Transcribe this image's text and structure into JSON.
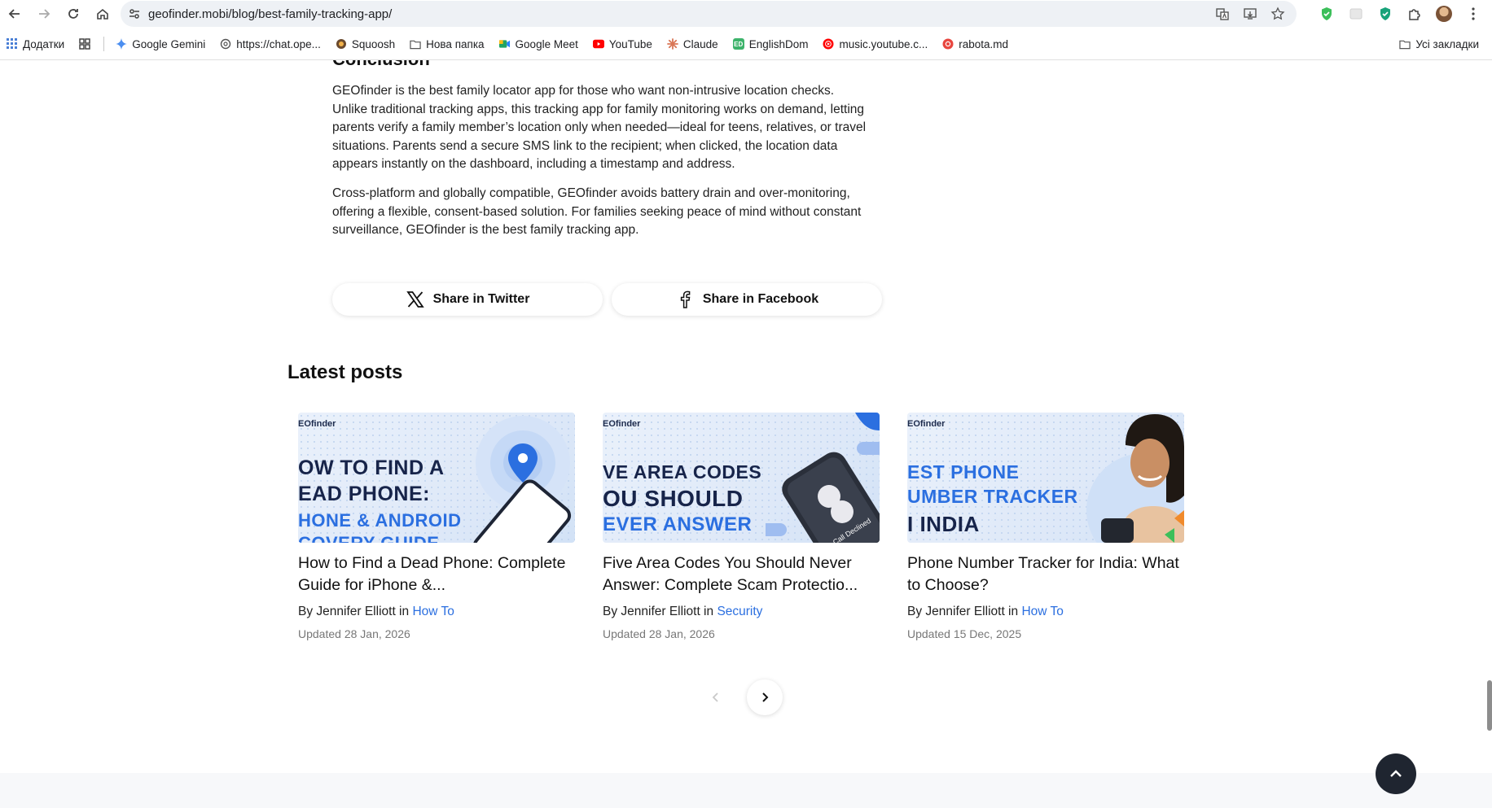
{
  "browser": {
    "url": "geofinder.mobi/blog/best-family-tracking-app/",
    "bookmarks": [
      {
        "label": "Додатки",
        "icon": "apps-grid-icon"
      },
      {
        "label": "Google Gemini",
        "icon": "gemini-icon"
      },
      {
        "label": "https://chat.ope...",
        "icon": "openai-icon"
      },
      {
        "label": "Squoosh",
        "icon": "squoosh-icon"
      },
      {
        "label": "Нова папка",
        "icon": "folder-icon"
      },
      {
        "label": "Google Meet",
        "icon": "meet-icon"
      },
      {
        "label": "YouTube",
        "icon": "youtube-icon"
      },
      {
        "label": "Claude",
        "icon": "claude-icon"
      },
      {
        "label": "EnglishDom",
        "icon": "englishdom-icon"
      },
      {
        "label": "music.youtube.c...",
        "icon": "youtube-music-icon"
      },
      {
        "label": "rabota.md",
        "icon": "rabota-icon"
      }
    ],
    "all_bookmarks": "Усі закладки"
  },
  "article": {
    "heading_cut": "Conclusion",
    "paragraphs": [
      "GEOfinder is the best family locator app for those who want non-intrusive location checks. Unlike traditional tracking apps, this tracking app for family monitoring works on demand, letting parents verify a family member’s location only when needed—ideal for teens, relatives, or travel situations. Parents send a secure SMS link to the recipient; when clicked, the location data appears instantly on the dashboard, including a timestamp and address.",
      "Cross-platform and globally compatible, GEOfinder avoids battery drain and over-monitoring, offering a flexible, consent-based solution. For families seeking peace of mind without constant surveillance, GEOfinder is the best family tracking app."
    ],
    "share_twitter": "Share in Twitter",
    "share_facebook": "Share in Facebook"
  },
  "latest": {
    "title": "Latest posts",
    "cards": [
      {
        "image_brand": "EOfinder",
        "image_lines": [
          "OW TO FIND A",
          "EAD PHONE:",
          "HONE & ANDROID",
          "COVERY GUIDE"
        ],
        "title": "How to Find a Dead Phone: Complete Guide for iPhone &...",
        "by": "By Jennifer Elliott in",
        "category": "How To",
        "date": "Updated 28 Jan, 2026"
      },
      {
        "image_brand": "EOfinder",
        "image_lines": [
          "VE AREA CODES",
          "OU SHOULD",
          "EVER ANSWER"
        ],
        "image_phone_text": "Call Declined",
        "title": "Five Area Codes You Should Never Answer: Complete Scam Protectio...",
        "by": "By Jennifer Elliott in",
        "category": "Security",
        "date": "Updated 28 Jan, 2026"
      },
      {
        "image_brand": "EOfinder",
        "image_lines": [
          "EST PHONE",
          "UMBER TRACKER",
          "I INDIA"
        ],
        "title": "Phone Number Tracker for India: What to Choose?",
        "by": "By Jennifer Elliott in",
        "category": "How To",
        "date": "Updated 15 Dec, 2025"
      }
    ]
  },
  "colors": {
    "accent_blue": "#2b6fe0",
    "dark_navy": "#17244a",
    "scroll_top_bg": "#1f2530"
  }
}
